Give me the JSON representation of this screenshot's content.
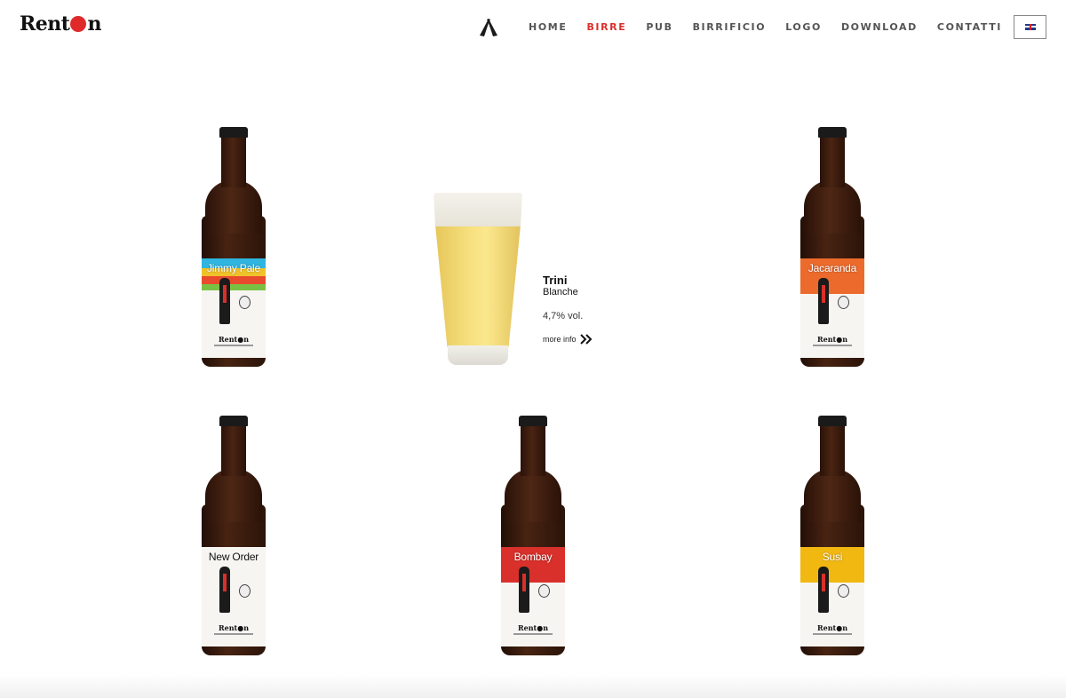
{
  "brand": {
    "name_part1": "Rent",
    "name_part2": "n"
  },
  "nav": {
    "icon": "crossed-bottles-icon",
    "items": [
      "HOME",
      "BIRRE",
      "PUB",
      "BIRRIFICIO",
      "LOGO",
      "DOWNLOAD",
      "CONTATTI"
    ],
    "active": "BIRRE",
    "language_icon": "uk-flag-icon"
  },
  "beers": [
    {
      "name": "Jimmy Pale",
      "label_color": "#e84a2e",
      "label_style": "rainbow"
    },
    {
      "name": "Jacaranda",
      "label_color": "#ec6a2c",
      "label_style": "solid"
    },
    {
      "name": "New Order",
      "label_color": "#ffffff",
      "label_style": "plain"
    },
    {
      "name": "Bombay",
      "label_color": "#d9302b",
      "label_style": "solid"
    },
    {
      "name": "Susi",
      "label_color": "#f2b812",
      "label_style": "solid"
    }
  ],
  "bottle_brand_text": "Rent●n",
  "featured": {
    "name": "Trini",
    "style": "Blanche",
    "abv": "4,7%  vol.",
    "more_label": "more info"
  },
  "colors": {
    "accent": "#d9302b",
    "nav_text": "#555555"
  }
}
